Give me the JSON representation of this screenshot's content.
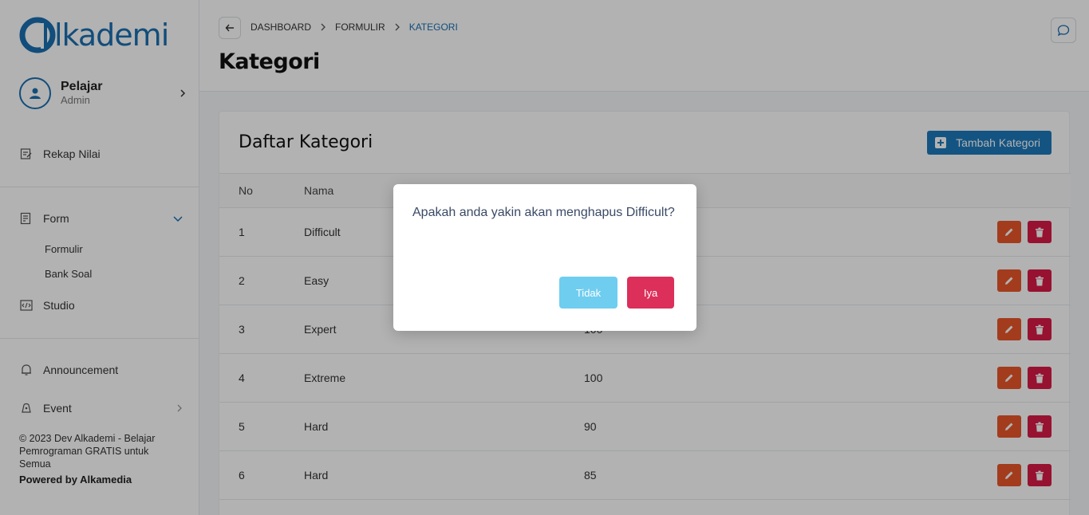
{
  "sidebar": {
    "logo_text": "lkademi",
    "user": {
      "name": "Pelajar",
      "role": "Admin"
    },
    "items": [
      {
        "label": "Rekap Nilai",
        "icon": "edit-note-icon"
      },
      {
        "label": "Form",
        "icon": "form-icon"
      },
      {
        "label": "Studio",
        "icon": "code-icon"
      },
      {
        "label": "Announcement",
        "icon": "bell-icon"
      },
      {
        "label": "Event",
        "icon": "event-icon"
      }
    ],
    "form_sub": [
      "Formulir",
      "Bank Soal"
    ],
    "footer": "© 2023 Dev Alkademi - Belajar Pemrograman GRATIS untuk Semua",
    "powered": "Powered by Alkamedia"
  },
  "header": {
    "breadcrumb": [
      "DASHBOARD",
      "FORMULIR",
      "KATEGORI"
    ],
    "title": "Kategori"
  },
  "card": {
    "title": "Daftar Kategori",
    "add_label": "Tambah Kategori",
    "columns": [
      "No",
      "Nama",
      ""
    ],
    "rows": [
      [
        "1",
        "Difficult",
        ""
      ],
      [
        "2",
        "Easy",
        ""
      ],
      [
        "3",
        "Expert",
        "100"
      ],
      [
        "4",
        "Extreme",
        "100"
      ],
      [
        "5",
        "Hard",
        "90"
      ],
      [
        "6",
        "Hard",
        "85"
      ]
    ]
  },
  "modal": {
    "message": "Apakah anda yakin akan menghapus Difficult?",
    "no_label": "Tidak",
    "yes_label": "Iya"
  },
  "colors": {
    "primary": "#1a6fb0",
    "edit": "#e8572a",
    "delete": "#d81b46",
    "cancel": "#6fcdf0",
    "confirm": "#dc2f5a"
  }
}
